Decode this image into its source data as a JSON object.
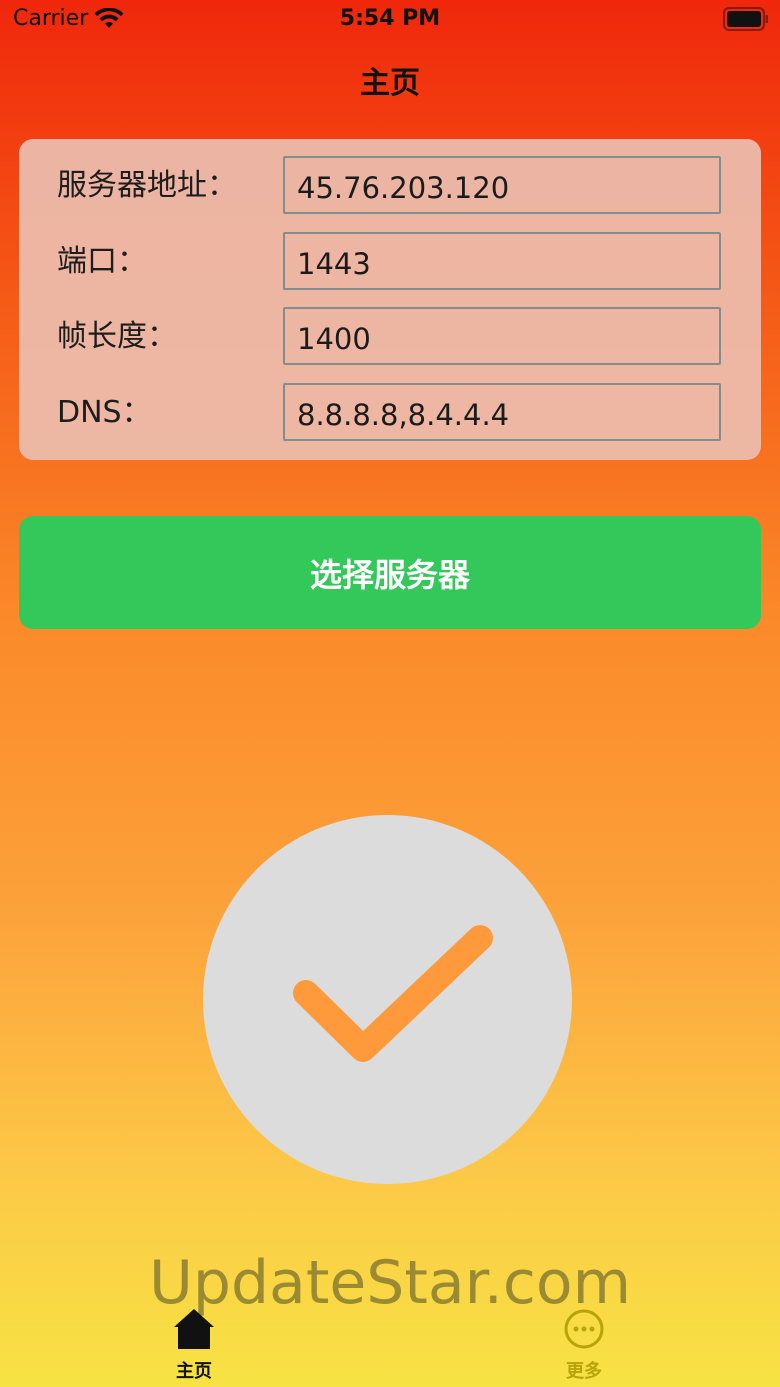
{
  "status_bar": {
    "carrier": "Carrier",
    "time": "5:54 PM",
    "icons": [
      "wifi-icon",
      "battery-icon"
    ]
  },
  "nav": {
    "title": "主页"
  },
  "form": {
    "fields": [
      {
        "label": "服务器地址：",
        "value": "45.76.203.120"
      },
      {
        "label": "端口：",
        "value": "1443"
      },
      {
        "label": "帧长度：",
        "value": "1400"
      },
      {
        "label": "DNS：",
        "value": "8.8.8.8,8.4.4.4"
      }
    ]
  },
  "select_server_button": {
    "label": "选择服务器",
    "color": "#34c85a"
  },
  "connect_button": {
    "icon": "checkmark-icon",
    "state": "connected",
    "circle_color": "#dcdcdc",
    "check_color": "#ff9a3c"
  },
  "watermark": {
    "text": "UpdateStar.com"
  },
  "tab_bar": {
    "tabs": [
      {
        "label": "主页",
        "icon": "home-icon",
        "selected": true
      },
      {
        "label": "更多",
        "icon": "more-icon",
        "selected": false
      }
    ],
    "active_color": "#111111",
    "inactive_color": "#b7a30c"
  }
}
